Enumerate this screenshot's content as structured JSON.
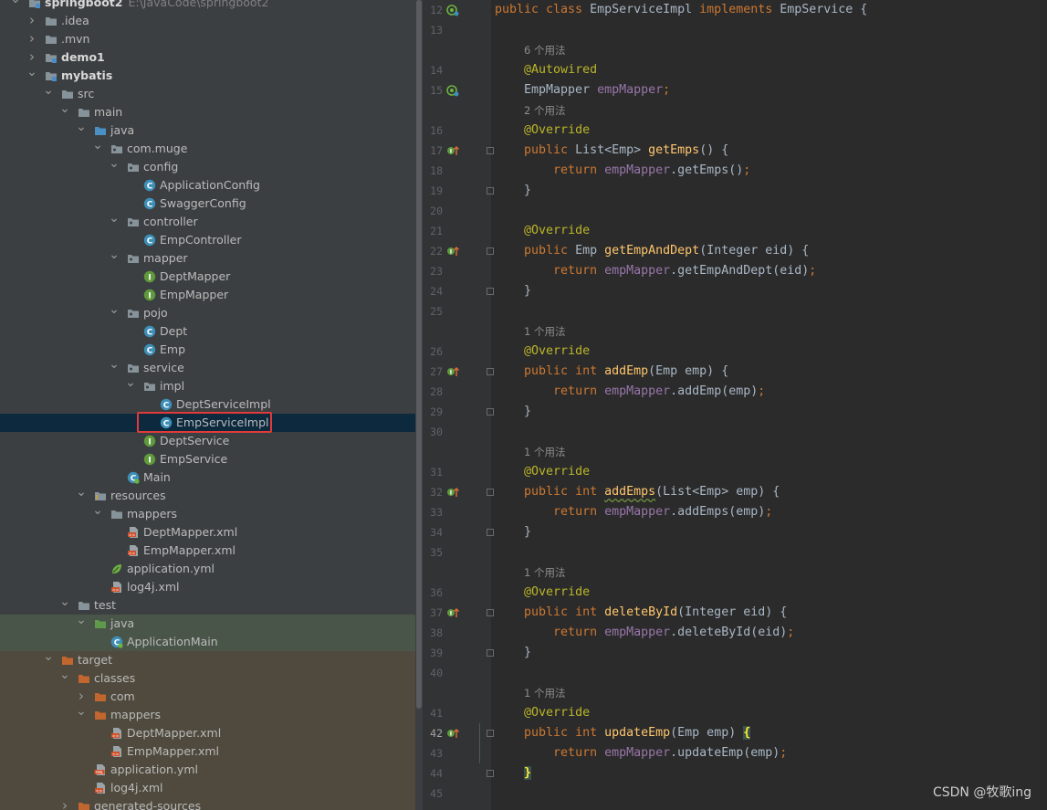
{
  "colors": {
    "tree_bg": "#3c3f41",
    "selection": "#0d293e",
    "test_band": "#4a5549",
    "target_band": "#4f4a3d",
    "editor_bg": "#2b2b2b",
    "gutter_bg": "#313335",
    "highlight_box": "#e03a3a",
    "keyword": "#cc7832",
    "annotation": "#bbb529",
    "field": "#9876aa",
    "method": "#ffc66d",
    "text": "#a9b7c6"
  },
  "project_tree": {
    "items": [
      {
        "label": "springboot2",
        "path": "E:\\JavaCode\\springboot2",
        "depth": 0,
        "arrow": "down",
        "icon": "module-folder-icon",
        "bold": true
      },
      {
        "label": ".idea",
        "depth": 1,
        "arrow": "right",
        "icon": "folder-icon"
      },
      {
        "label": ".mvn",
        "depth": 1,
        "arrow": "right",
        "icon": "folder-icon"
      },
      {
        "label": "demo1",
        "depth": 1,
        "arrow": "right",
        "icon": "module-folder-icon",
        "bold": true
      },
      {
        "label": "mybatis",
        "depth": 1,
        "arrow": "down",
        "icon": "module-folder-icon",
        "bold": true
      },
      {
        "label": "src",
        "depth": 2,
        "arrow": "down",
        "icon": "folder-icon"
      },
      {
        "label": "main",
        "depth": 3,
        "arrow": "down",
        "icon": "folder-icon"
      },
      {
        "label": "java",
        "depth": 4,
        "arrow": "down",
        "icon": "source-folder-icon"
      },
      {
        "label": "com.muge",
        "depth": 5,
        "arrow": "down",
        "icon": "package-icon"
      },
      {
        "label": "config",
        "depth": 6,
        "arrow": "down",
        "icon": "package-icon"
      },
      {
        "label": "ApplicationConfig",
        "depth": 7,
        "icon": "class-icon"
      },
      {
        "label": "SwaggerConfig",
        "depth": 7,
        "icon": "class-icon"
      },
      {
        "label": "controller",
        "depth": 6,
        "arrow": "down",
        "icon": "package-icon"
      },
      {
        "label": "EmpController",
        "depth": 7,
        "icon": "class-icon"
      },
      {
        "label": "mapper",
        "depth": 6,
        "arrow": "down",
        "icon": "package-icon"
      },
      {
        "label": "DeptMapper",
        "depth": 7,
        "icon": "interface-icon"
      },
      {
        "label": "EmpMapper",
        "depth": 7,
        "icon": "interface-icon"
      },
      {
        "label": "pojo",
        "depth": 6,
        "arrow": "down",
        "icon": "package-icon"
      },
      {
        "label": "Dept",
        "depth": 7,
        "icon": "class-icon"
      },
      {
        "label": "Emp",
        "depth": 7,
        "icon": "class-icon"
      },
      {
        "label": "service",
        "depth": 6,
        "arrow": "down",
        "icon": "package-icon"
      },
      {
        "label": "impl",
        "depth": 7,
        "arrow": "down",
        "icon": "package-icon"
      },
      {
        "label": "DeptServiceImpl",
        "depth": 8,
        "icon": "class-icon"
      },
      {
        "label": "EmpServiceImpl",
        "depth": 8,
        "icon": "class-icon",
        "selected": true
      },
      {
        "label": "DeptService",
        "depth": 7,
        "icon": "interface-icon"
      },
      {
        "label": "EmpService",
        "depth": 7,
        "icon": "interface-icon"
      },
      {
        "label": "Main",
        "depth": 6,
        "icon": "spring-boot-class-icon"
      },
      {
        "label": "resources",
        "depth": 4,
        "arrow": "down",
        "icon": "resources-folder-icon"
      },
      {
        "label": "mappers",
        "depth": 5,
        "arrow": "down",
        "icon": "folder-icon"
      },
      {
        "label": "DeptMapper.xml",
        "depth": 6,
        "icon": "xml-file-icon"
      },
      {
        "label": "EmpMapper.xml",
        "depth": 6,
        "icon": "xml-file-icon"
      },
      {
        "label": "application.yml",
        "depth": 5,
        "icon": "spring-yml-icon"
      },
      {
        "label": "log4j.xml",
        "depth": 5,
        "icon": "xml-file-icon"
      },
      {
        "label": "test",
        "depth": 3,
        "arrow": "down",
        "icon": "folder-icon"
      },
      {
        "label": "java",
        "depth": 4,
        "arrow": "down",
        "icon": "test-source-folder-icon"
      },
      {
        "label": "ApplicationMain",
        "depth": 5,
        "icon": "spring-boot-class-icon"
      },
      {
        "label": "target",
        "depth": 2,
        "arrow": "down",
        "icon": "excluded-folder-icon"
      },
      {
        "label": "classes",
        "depth": 3,
        "arrow": "down",
        "icon": "excluded-folder-icon"
      },
      {
        "label": "com",
        "depth": 4,
        "arrow": "right",
        "icon": "excluded-folder-icon"
      },
      {
        "label": "mappers",
        "depth": 4,
        "arrow": "down",
        "icon": "excluded-folder-icon"
      },
      {
        "label": "DeptMapper.xml",
        "depth": 5,
        "icon": "xml-file-icon"
      },
      {
        "label": "EmpMapper.xml",
        "depth": 5,
        "icon": "xml-file-icon"
      },
      {
        "label": "application.yml",
        "depth": 4,
        "icon": "yml-file-icon"
      },
      {
        "label": "log4j.xml",
        "depth": 4,
        "icon": "xml-file-icon"
      },
      {
        "label": "generated-sources",
        "depth": 3,
        "arrow": "right",
        "icon": "excluded-folder-icon"
      }
    ]
  },
  "editor": {
    "lines": [
      {
        "n": "12",
        "tokens": [
          [
            "kw",
            "public class "
          ],
          [
            "",
            "EmpServiceImpl "
          ],
          [
            "kw",
            "implements "
          ],
          [
            "",
            "EmpService {"
          ]
        ],
        "gutter": "bean-icon"
      },
      {
        "n": "13",
        "tokens": []
      },
      {
        "hint": "6 个用法"
      },
      {
        "n": "14",
        "tokens": [
          [
            "",
            "    "
          ],
          [
            "an",
            "@Autowired"
          ]
        ]
      },
      {
        "n": "15",
        "tokens": [
          [
            "",
            "    EmpMapper "
          ],
          [
            "fld",
            "empMapper"
          ],
          [
            "kw",
            ";"
          ]
        ],
        "gutter": "bean-icon"
      },
      {
        "hint": "2 个用法"
      },
      {
        "n": "16",
        "tokens": [
          [
            "",
            "    "
          ],
          [
            "an",
            "@Override"
          ]
        ]
      },
      {
        "n": "17",
        "tokens": [
          [
            "",
            "    "
          ],
          [
            "kw",
            "public "
          ],
          [
            "",
            "List<Emp> "
          ],
          [
            "mth",
            "getEmps"
          ],
          [
            "",
            "() {"
          ]
        ],
        "gutter": "override-icon",
        "fold": true
      },
      {
        "n": "18",
        "tokens": [
          [
            "",
            "        "
          ],
          [
            "kw",
            "return "
          ],
          [
            "fld",
            "empMapper"
          ],
          [
            "",
            ".getEmps()"
          ],
          [
            "kw",
            ";"
          ]
        ]
      },
      {
        "n": "19",
        "tokens": [
          [
            "",
            "    }"
          ]
        ],
        "fold": true
      },
      {
        "n": "20",
        "tokens": []
      },
      {
        "n": "21",
        "tokens": [
          [
            "",
            "    "
          ],
          [
            "an",
            "@Override"
          ]
        ]
      },
      {
        "n": "22",
        "tokens": [
          [
            "",
            "    "
          ],
          [
            "kw",
            "public "
          ],
          [
            "",
            "Emp "
          ],
          [
            "mth",
            "getEmpAndDept"
          ],
          [
            "",
            "(Integer eid) {"
          ]
        ],
        "gutter": "override-icon",
        "fold": true
      },
      {
        "n": "23",
        "tokens": [
          [
            "",
            "        "
          ],
          [
            "kw",
            "return "
          ],
          [
            "fld",
            "empMapper"
          ],
          [
            "",
            ".getEmpAndDept(eid)"
          ],
          [
            "kw",
            ";"
          ]
        ]
      },
      {
        "n": "24",
        "tokens": [
          [
            "",
            "    }"
          ]
        ],
        "fold": true
      },
      {
        "n": "25",
        "tokens": []
      },
      {
        "hint": "1 个用法"
      },
      {
        "n": "26",
        "tokens": [
          [
            "",
            "    "
          ],
          [
            "an",
            "@Override"
          ]
        ]
      },
      {
        "n": "27",
        "tokens": [
          [
            "",
            "    "
          ],
          [
            "kw",
            "public int "
          ],
          [
            "mth",
            "addEmp"
          ],
          [
            "",
            "(Emp emp) {"
          ]
        ],
        "gutter": "override-icon",
        "fold": true
      },
      {
        "n": "28",
        "tokens": [
          [
            "",
            "        "
          ],
          [
            "kw",
            "return "
          ],
          [
            "fld",
            "empMapper"
          ],
          [
            "",
            ".addEmp(emp)"
          ],
          [
            "kw",
            ";"
          ]
        ]
      },
      {
        "n": "29",
        "tokens": [
          [
            "",
            "    }"
          ]
        ],
        "fold": true
      },
      {
        "n": "30",
        "tokens": []
      },
      {
        "hint": "1 个用法"
      },
      {
        "n": "31",
        "tokens": [
          [
            "",
            "    "
          ],
          [
            "an",
            "@Override"
          ]
        ]
      },
      {
        "n": "32",
        "tokens": [
          [
            "",
            "    "
          ],
          [
            "kw",
            "public int "
          ],
          [
            "mth wavy",
            "addEmps"
          ],
          [
            "",
            "(List<Emp> emp) {"
          ]
        ],
        "gutter": "override-icon",
        "fold": true
      },
      {
        "n": "33",
        "tokens": [
          [
            "",
            "        "
          ],
          [
            "kw",
            "return "
          ],
          [
            "fld",
            "empMapper"
          ],
          [
            "",
            ".addEmps(emp)"
          ],
          [
            "kw",
            ";"
          ]
        ]
      },
      {
        "n": "34",
        "tokens": [
          [
            "",
            "    }"
          ]
        ],
        "fold": true
      },
      {
        "n": "35",
        "tokens": []
      },
      {
        "hint": "1 个用法"
      },
      {
        "n": "36",
        "tokens": [
          [
            "",
            "    "
          ],
          [
            "an",
            "@Override"
          ]
        ]
      },
      {
        "n": "37",
        "tokens": [
          [
            "",
            "    "
          ],
          [
            "kw",
            "public int "
          ],
          [
            "mth",
            "deleteById"
          ],
          [
            "",
            "(Integer eid) {"
          ]
        ],
        "gutter": "override-icon",
        "fold": true
      },
      {
        "n": "38",
        "tokens": [
          [
            "",
            "        "
          ],
          [
            "kw",
            "return "
          ],
          [
            "fld",
            "empMapper"
          ],
          [
            "",
            ".deleteById(eid)"
          ],
          [
            "kw",
            ";"
          ]
        ]
      },
      {
        "n": "39",
        "tokens": [
          [
            "",
            "    }"
          ]
        ],
        "fold": true
      },
      {
        "n": "40",
        "tokens": []
      },
      {
        "hint": "1 个用法"
      },
      {
        "n": "41",
        "tokens": [
          [
            "",
            "    "
          ],
          [
            "an",
            "@Override"
          ]
        ]
      },
      {
        "n": "42",
        "tokens": [
          [
            "",
            "    "
          ],
          [
            "kw",
            "public int "
          ],
          [
            "mth",
            "updateEmp"
          ],
          [
            "",
            "(Emp emp) "
          ],
          [
            "brace",
            "{"
          ]
        ],
        "gutter": "override-icon",
        "fold": true,
        "current": true
      },
      {
        "n": "43",
        "tokens": [
          [
            "",
            "        "
          ],
          [
            "kw",
            "return "
          ],
          [
            "fld",
            "empMapper"
          ],
          [
            "",
            ".updateEmp(emp)"
          ],
          [
            "kw",
            ";"
          ]
        ]
      },
      {
        "n": "44",
        "tokens": [
          [
            "",
            "    "
          ],
          [
            "brace",
            "}"
          ]
        ],
        "fold": true
      },
      {
        "n": "45",
        "tokens": []
      }
    ]
  },
  "watermark": "CSDN @牧歌ing"
}
